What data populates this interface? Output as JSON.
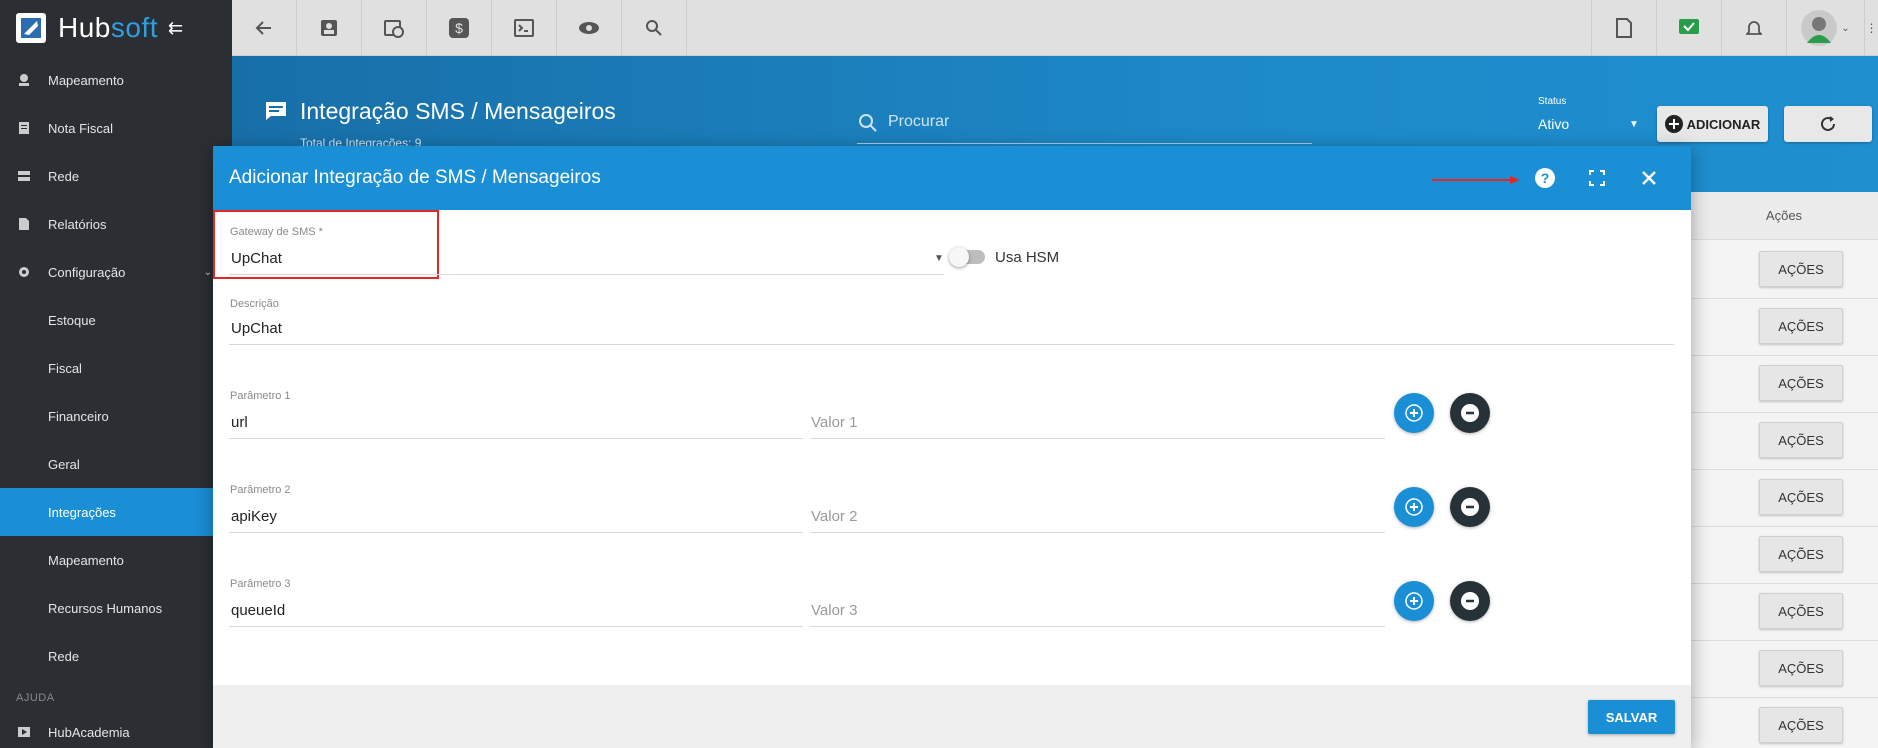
{
  "app": {
    "logo_main": "Hub",
    "logo_accent": "soft"
  },
  "sidebar": {
    "items": [
      {
        "label": "Mapeamento",
        "icon": "map-pin-icon"
      },
      {
        "label": "Nota Fiscal",
        "icon": "receipt-icon"
      },
      {
        "label": "Rede",
        "icon": "server-icon"
      },
      {
        "label": "Relatórios",
        "icon": "report-icon"
      },
      {
        "label": "Configuração",
        "icon": "gear-icon"
      }
    ],
    "sub_items": [
      {
        "label": "Estoque"
      },
      {
        "label": "Fiscal"
      },
      {
        "label": "Financeiro"
      },
      {
        "label": "Geral"
      },
      {
        "label": "Integrações",
        "active": true
      },
      {
        "label": "Mapeamento"
      },
      {
        "label": "Recursos Humanos"
      },
      {
        "label": "Rede"
      }
    ],
    "section_help": "AJUDA",
    "help_items": [
      {
        "label": "HubAcademia",
        "icon": "play-icon"
      }
    ]
  },
  "page": {
    "title": "Integração SMS / Mensageiros",
    "subtitle": "Total de Integrações: 9",
    "search_placeholder": "Procurar",
    "status_label": "Status",
    "status_value": "Ativo",
    "add_label": "ADICIONAR"
  },
  "table": {
    "col_actions": "Ações",
    "row_action_label": "AÇÕES",
    "row_count": 9
  },
  "modal": {
    "title": "Adicionar Integração de SMS / Mensageiros",
    "gateway_label": "Gateway de SMS *",
    "gateway_value": "UpChat",
    "hsm_label": "Usa HSM",
    "hsm_on": false,
    "descricao_label": "Descrição",
    "descricao_value": "UpChat",
    "params": [
      {
        "label": "Parâmetro 1",
        "value": "url",
        "value_placeholder": "Valor 1"
      },
      {
        "label": "Parâmetro 2",
        "value": "apiKey",
        "value_placeholder": "Valor 2"
      },
      {
        "label": "Parâmetro 3",
        "value": "queueId",
        "value_placeholder": "Valor 3"
      }
    ],
    "save_label": "SALVAR"
  },
  "colors": {
    "primary": "#1a8fd6",
    "sidebar": "#2b2f33",
    "highlight": "#e32626"
  }
}
